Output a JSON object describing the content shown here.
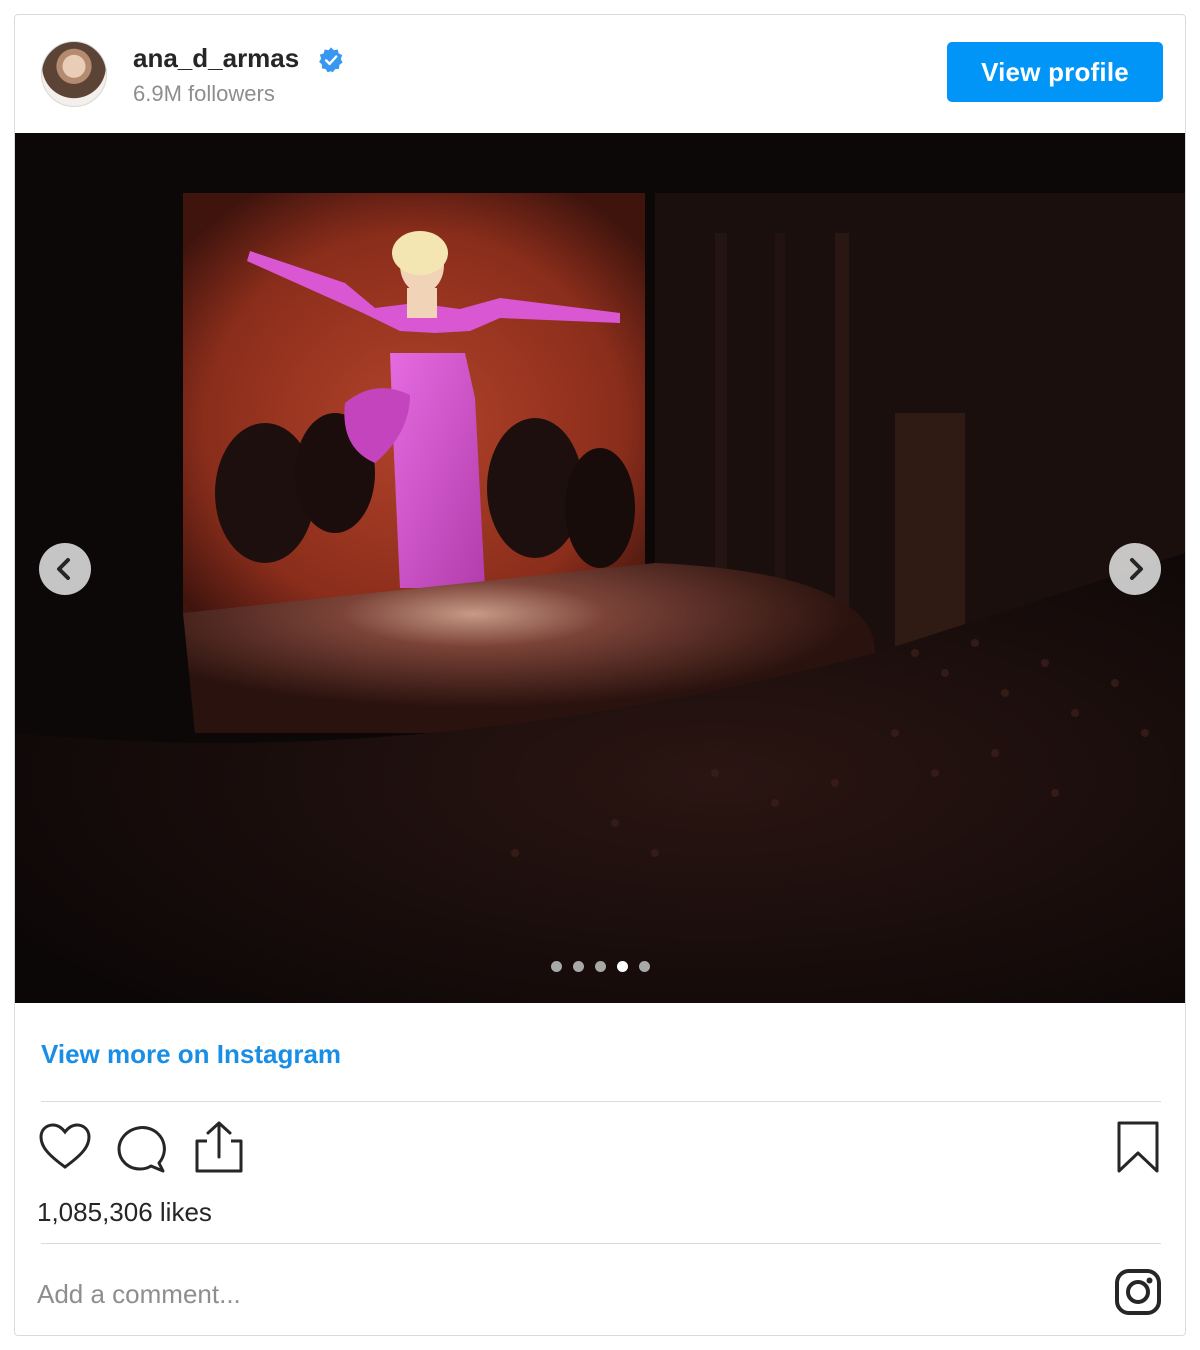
{
  "post": {
    "username": "ana_d_armas",
    "followers": "6.9M followers",
    "view_profile_label": "View profile",
    "view_more_label": "View more on Instagram",
    "likes": "1,085,306 likes",
    "comment_placeholder": "Add a comment...",
    "carousel": {
      "dot_count": 5,
      "active_index": 3
    },
    "icons": {
      "verified": "verified-badge-icon",
      "like": "heart-icon",
      "comment": "comment-bubble-icon",
      "share": "share-icon",
      "save": "bookmark-icon",
      "instagram": "instagram-logo-icon",
      "prev": "chevron-left-icon",
      "next": "chevron-right-icon"
    },
    "colors": {
      "accent": "#0095f6",
      "link": "#1a8ee5",
      "dress": "#d14fc9"
    }
  }
}
